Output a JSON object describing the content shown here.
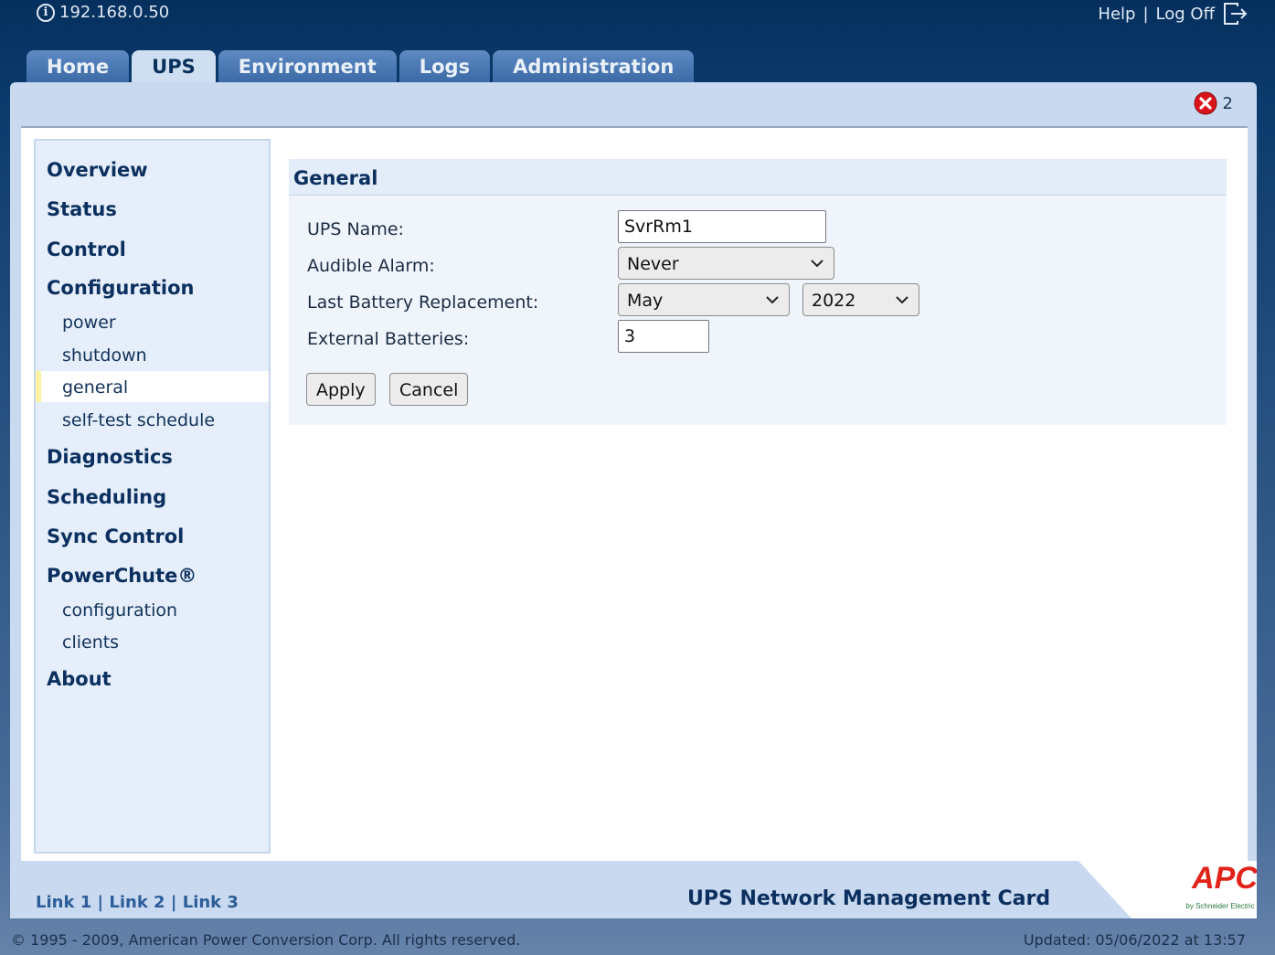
{
  "header": {
    "host": "192.168.0.50",
    "help": "Help",
    "separator": "|",
    "logoff": "Log Off"
  },
  "tabs": [
    {
      "label": "Home"
    },
    {
      "label": "UPS",
      "active": true
    },
    {
      "label": "Environment"
    },
    {
      "label": "Logs"
    },
    {
      "label": "Administration"
    }
  ],
  "alerts": {
    "count": "2"
  },
  "sidebar": {
    "overview": "Overview",
    "status": "Status",
    "control": "Control",
    "configuration": "Configuration",
    "config_items": [
      "power",
      "shutdown",
      "general",
      "self-test schedule"
    ],
    "active_item": "general",
    "diagnostics": "Diagnostics",
    "scheduling": "Scheduling",
    "sync_control": "Sync Control",
    "powerchute": "PowerChute®",
    "powerchute_items": [
      "configuration",
      "clients"
    ],
    "about": "About"
  },
  "form": {
    "title": "General",
    "ups_name_label": "UPS Name:",
    "ups_name_value": "SvrRm1",
    "alarm_label": "Audible Alarm:",
    "alarm_value": "Never",
    "battery_label": "Last Battery Replacement:",
    "battery_month": "May",
    "battery_year": "2022",
    "external_label": "External Batteries:",
    "external_value": "3",
    "apply": "Apply",
    "cancel": "Cancel"
  },
  "footer": {
    "link1": "Link 1",
    "link2": "Link 2",
    "link3": "Link 3",
    "sep": "|",
    "product": "UPS Network Management Card",
    "logo_text": "APC",
    "logo_sub": "by Schneider Electric",
    "copyright": "© 1995 - 2009, American Power Conversion Corp. All rights reserved.",
    "updated": "Updated: 05/06/2022 at 13:57"
  },
  "colors": {
    "brand_navy": "#0b2f5e",
    "apc_red": "#e2231a",
    "alert_red": "#d9141b"
  }
}
